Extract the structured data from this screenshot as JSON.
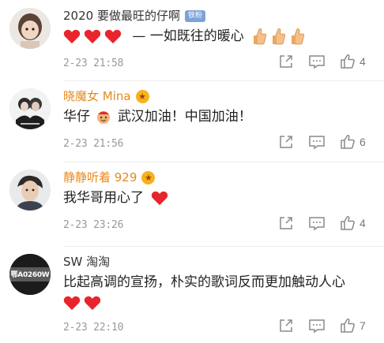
{
  "comments": [
    {
      "name": "2020 要做最旺的仔啊",
      "badge": "铁粉",
      "body_text": "一如既往的暖心",
      "time": "2-23 21:58",
      "likes": "4"
    },
    {
      "name": "晓魔女 Mina",
      "body_prefix": "华仔",
      "body_text": "武汉加油！中国加油！",
      "time": "2-23 21:56",
      "likes": "6"
    },
    {
      "name": "静静听着 929",
      "body_text": "我华哥用心了",
      "time": "2-23 23:26",
      "likes": "4"
    },
    {
      "name": "SW 淘淘",
      "avatar_text": "鄂A0260W",
      "body_text": "比起高调的宣扬，朴实的歌词反而更加触动人心",
      "time": "2-23 22:10",
      "likes": "7"
    }
  ],
  "colors": {
    "gold_name": "#e58a1f",
    "heart": "#e8242c",
    "meta": "#999999",
    "icon": "#8a8a8a"
  },
  "icons": [
    "share-icon",
    "reply-icon",
    "like-icon",
    "heart-icon",
    "thumbs-up-icon",
    "cheer-icon",
    "vip-icon"
  ]
}
